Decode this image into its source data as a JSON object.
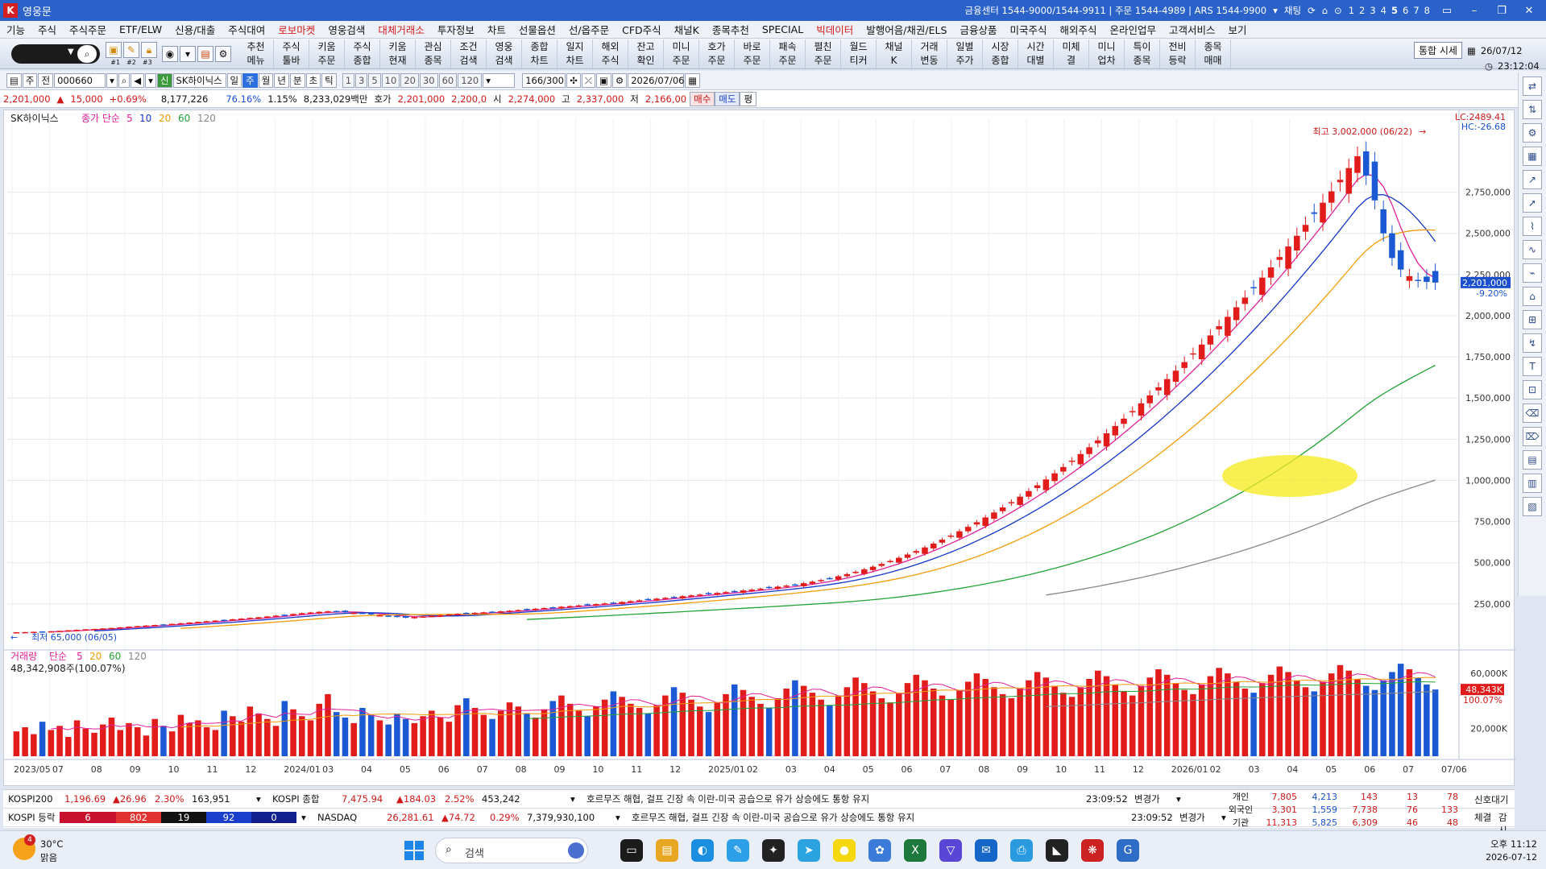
{
  "window": {
    "title": "영웅문",
    "contacts": "금융센터 1544-9000/1544-9911  |  주문 1544-4989  |  ARS 1544-9900",
    "chat_label": "채팅",
    "page_numbers": [
      "1",
      "2",
      "3",
      "4",
      "5",
      "6",
      "7",
      "8"
    ],
    "active_page": "5"
  },
  "menu": [
    "기능",
    "주식",
    "주식주문",
    "ETF/ELW",
    "신용/대출",
    "주식대여",
    "로보마켓",
    "영웅검색",
    "대체거래소",
    "투자정보",
    "차트",
    "선물옵션",
    "선/옵주문",
    "CFD주식",
    "채널K",
    "종목추천",
    "SPECIAL",
    "빅데이터",
    "발행어음/채권/ELS",
    "금융상품",
    "미국주식",
    "해외주식",
    "온라인업무",
    "고객서비스",
    "보기"
  ],
  "menu_red": [
    "로보마켓",
    "대체거래소",
    "빅데이터"
  ],
  "toolbar": {
    "small_labels": [
      "#1",
      "#2",
      "#3"
    ],
    "buttons": [
      [
        "추천",
        "메뉴"
      ],
      [
        "주식",
        "툴바"
      ],
      [
        "키움",
        "주문"
      ],
      [
        "주식",
        "종합"
      ],
      [
        "키움",
        "현재"
      ],
      [
        "관심",
        "종목"
      ],
      [
        "조건",
        "검색"
      ],
      [
        "영웅",
        "검색"
      ],
      [
        "종합",
        "차트"
      ],
      [
        "일지",
        "차트"
      ],
      [
        "해외",
        "주식"
      ],
      [
        "잔고",
        "확인"
      ],
      [
        "미니",
        "주문"
      ],
      [
        "호가",
        "주문"
      ],
      [
        "바로",
        "주문"
      ],
      [
        "패속",
        "주문"
      ],
      [
        "펼친",
        "주문"
      ],
      [
        "월드",
        "티커"
      ],
      [
        "채널",
        "K"
      ],
      [
        "거래",
        "변동"
      ],
      [
        "일별",
        "주가"
      ],
      [
        "시장",
        "종합"
      ],
      [
        "시간",
        "대별"
      ],
      [
        "미체",
        "결"
      ],
      [
        "미니",
        "업차"
      ],
      [
        "특이",
        "종목"
      ],
      [
        "전비",
        "등락"
      ],
      [
        "종목",
        "매매"
      ]
    ],
    "integrated_btn": "통합 시세",
    "date": "26/07/12",
    "time": "23:12:04"
  },
  "chartbar": {
    "mode1": "주",
    "mode2": "전",
    "code": "000660",
    "name": "SK하이닉스",
    "periods": [
      "일",
      "주",
      "월",
      "년",
      "분",
      "초",
      "틱"
    ],
    "active_period": "주",
    "nums": [
      "1",
      "3",
      "5",
      "10",
      "20",
      "30",
      "60",
      "120"
    ],
    "count": "166/300",
    "date": "2026/07/06"
  },
  "quote": {
    "price": "2,201,000",
    "change": "15,000",
    "pct": "+0.69%",
    "volume": "8,177,226",
    "rate": "76.16%",
    "turnover": "1.15%",
    "amount": "8,233,029백만",
    "ask_label": "호가",
    "ask1": "2,201,000",
    "ask2": "2,200,0",
    "open_label": "시",
    "open": "2,274,000",
    "high_label": "고",
    "high": "2,337,000",
    "low_label": "저",
    "low": "2,166,00",
    "buy": "매수",
    "sell": "매도",
    "even": "평"
  },
  "price_legend": {
    "name": "SK하이닉스",
    "type": "종가 단순",
    "ma": [
      "5",
      "10",
      "20",
      "60",
      "120"
    ],
    "ma_colors": [
      "#e0209a",
      "#1536c9",
      "#f39c0b",
      "#23a236",
      "#888888"
    ]
  },
  "price_axis": {
    "lc": "LC:2489.41",
    "hc": "HC:-26.68",
    "labels": [
      "2,750,000",
      "2,500,000",
      "2,250,000",
      "2,000,000",
      "1,750,000",
      "1,500,000",
      "1,250,000",
      "1,000,000",
      "750,000",
      "500,000",
      "250,000"
    ],
    "last_price": "2,201,000",
    "last_pct": "-9.20%"
  },
  "annotations": {
    "high": "최고 3,002,000 (06/22)",
    "low": "최저 65,000 (06/05)"
  },
  "volume_legend": {
    "name": "거래량",
    "type": "단순",
    "ma": [
      "5",
      "20",
      "60",
      "120"
    ],
    "ma_colors": [
      "#e0209a",
      "#f39c0b",
      "#23a236",
      "#888888"
    ],
    "value": "48,342,908주(100.07%)"
  },
  "volume_axis": {
    "labels": [
      "60,000K",
      "20,000K"
    ],
    "last": "48,343K",
    "last_pct": "100.07%"
  },
  "x_labels": [
    "2023/05",
    "07",
    "08",
    "09",
    "10",
    "11",
    "12",
    "2024/01",
    "03",
    "04",
    "05",
    "06",
    "07",
    "08",
    "09",
    "10",
    "11",
    "12",
    "2025/01",
    "02",
    "03",
    "04",
    "05",
    "06",
    "07",
    "08",
    "09",
    "10",
    "11",
    "12",
    "2026/01",
    "02",
    "03",
    "04",
    "05",
    "06",
    "07",
    "07/06"
  ],
  "chart_data": {
    "type": "candlestick",
    "title": "SK하이닉스",
    "period": "weekly",
    "ylim": [
      0,
      3100000
    ],
    "max_label": "최고 3,002,000 (06/22)",
    "min_label": "최저 65,000 (06/05)",
    "last_close": 2201000,
    "closes": [
      78000,
      79000,
      80500,
      82000,
      84000,
      86500,
      90000,
      93000,
      96000,
      98000,
      101000,
      104000,
      108000,
      112000,
      115000,
      119000,
      122000,
      125000,
      129000,
      133000,
      137000,
      141000,
      145000,
      149000,
      153000,
      157000,
      161000,
      165000,
      169000,
      174000,
      179000,
      184000,
      189000,
      194000,
      198000,
      202000,
      205000,
      203000,
      200000,
      196000,
      191000,
      186000,
      181000,
      176000,
      171000,
      166000,
      170000,
      174000,
      178000,
      182000,
      186000,
      190000,
      193000,
      196000,
      199000,
      202000,
      205000,
      209000,
      213000,
      217000,
      221000,
      225000,
      229000,
      233000,
      237000,
      241000,
      245000,
      249000,
      253000,
      257000,
      262000,
      267000,
      272000,
      277000,
      282000,
      287000,
      292000,
      297000,
      302000,
      307000,
      312000,
      317000,
      322000,
      327000,
      332000,
      337000,
      343000,
      349000,
      355000,
      361000,
      368000,
      376000,
      385000,
      395000,
      406000,
      418000,
      431000,
      445000,
      460000,
      476000,
      493000,
      511000,
      530000,
      550000,
      571000,
      593000,
      616000,
      640000,
      665000,
      691000,
      718000,
      746000,
      775000,
      805000,
      836000,
      868000,
      901000,
      935000,
      970000,
      1006000,
      1043000,
      1081000,
      1120000,
      1160000,
      1201000,
      1243000,
      1286000,
      1330000,
      1375000,
      1421000,
      1468000,
      1516000,
      1565000,
      1615000,
      1666000,
      1718000,
      1771000,
      1825000,
      1880000,
      1936000,
      1993000,
      2051000,
      2110000,
      2170000,
      2231000,
      2293000,
      2356000,
      2420000,
      2485000,
      2551000,
      2618000,
      2686000,
      2755000,
      2825000,
      2896000,
      2968000,
      2850000,
      2700000,
      2500000,
      2350000,
      2280000,
      2240000,
      2215000,
      2205000,
      2201000
    ],
    "volume_k": [
      18000,
      21000,
      16000,
      25000,
      19000,
      22000,
      14000,
      26000,
      20000,
      17000,
      23000,
      28000,
      19000,
      24000,
      21000,
      15000,
      27000,
      22000,
      18000,
      30000,
      24000,
      26000,
      21000,
      19000,
      33000,
      29000,
      25000,
      36000,
      31000,
      27000,
      22000,
      40000,
      34000,
      29000,
      26000,
      38000,
      45000,
      32000,
      28000,
      24000,
      35000,
      30000,
      26000,
      23000,
      31000,
      27000,
      24000,
      29000,
      33000,
      28000,
      25000,
      37000,
      42000,
      35000,
      30000,
      27000,
      33000,
      39000,
      36000,
      31000,
      28000,
      34000,
      40000,
      44000,
      38000,
      33000,
      29000,
      36000,
      41000,
      47000,
      43000,
      38000,
      35000,
      31000,
      37000,
      44000,
      50000,
      46000,
      41000,
      36000,
      32000,
      39000,
      45000,
      52000,
      48000,
      43000,
      38000,
      35000,
      42000,
      49000,
      55000,
      51000,
      46000,
      41000,
      37000,
      44000,
      50000,
      57000,
      53000,
      47000,
      42000,
      39000,
      46000,
      53000,
      59000,
      55000,
      49000,
      44000,
      41000,
      48000,
      54000,
      60000,
      56000,
      50000,
      45000,
      42000,
      49000,
      55000,
      61000,
      57000,
      51000,
      46000,
      43000,
      50000,
      56000,
      62000,
      58000,
      52000,
      47000,
      44000,
      51000,
      57000,
      63000,
      59000,
      53000,
      48000,
      45000,
      52000,
      58000,
      64000,
      60000,
      54000,
      49000,
      46000,
      53000,
      59000,
      65000,
      61000,
      55000,
      50000,
      47000,
      54000,
      60000,
      66000,
      62000,
      56000,
      51000,
      48000,
      55000,
      61000,
      67000,
      63000,
      57000,
      52000,
      48343
    ]
  },
  "tickers": [
    {
      "name": "KOSPI200",
      "value": "1,196.69",
      "change": "▲26.96",
      "pct": "2.30%",
      "vol": "163,951",
      "name2": "KOSPI 종합",
      "value2": "7,475.94",
      "change2": "▲184.03",
      "pct2": "2.52%",
      "vol2": "453,242",
      "news": "호르무즈 해협, 걸프 긴장 속 이란-미국 공습으로 유가 상승에도 통항 유지",
      "time": "23:09:52",
      "type": "변경가"
    },
    {
      "name": "KOSPI 등락",
      "up": "6",
      "up2": "802",
      "flat": "19",
      "down": "92",
      "down2": "0",
      "name2": "NASDAQ",
      "value2": "26,281.61",
      "change2": "▲74.72",
      "pct2": "0.29%",
      "vol2": "7,379,930,100",
      "news": "호르무즈 해협, 걸프 긴장 속 이란-미국 공습으로 유가 상승에도 통항 유지",
      "time": "23:09:52",
      "type": "변경가"
    }
  ],
  "investors": {
    "rows": [
      {
        "label": "개인",
        "v": [
          "7,805",
          "4,213",
          "143",
          "13",
          "78"
        ]
      },
      {
        "label": "외국인",
        "v": [
          "3,301",
          "1,559",
          "7,738",
          "76",
          "133"
        ]
      },
      {
        "label": "기관",
        "v": [
          "11,313",
          "5,825",
          "6,309",
          "46",
          "48"
        ]
      }
    ],
    "signal": "신호대기",
    "exec": "체결",
    "watch": "감시"
  },
  "taskbar": {
    "temp": "30°C",
    "weather": "맑음",
    "weather_badge": "4",
    "search": "검색",
    "time": "오후 11:12",
    "date": "2026-07-12"
  }
}
